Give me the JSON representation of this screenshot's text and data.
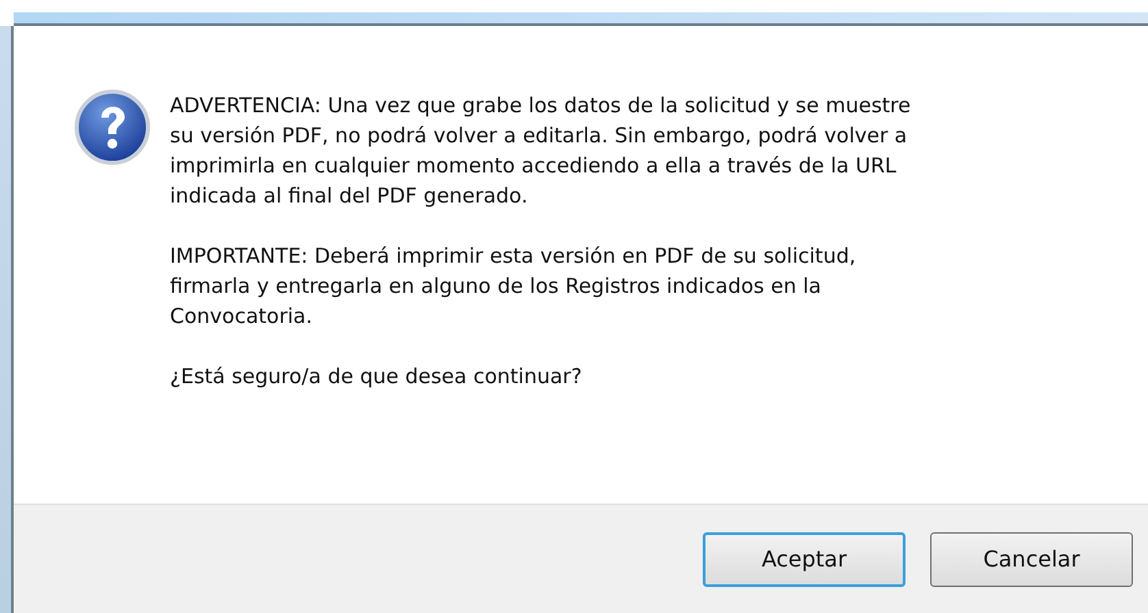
{
  "dialog": {
    "paragraphs": [
      {
        "lines": [
          "ADVERTENCIA: Una vez que grabe los datos de la solicitud y se muestre",
          "su versión PDF, no podrá volver a editarla. Sin embargo, podrá volver a",
          "imprimirla en cualquier momento accediendo a ella a través de la URL",
          "indicada al final del PDF generado."
        ]
      },
      {
        "lines": [
          "IMPORTANTE: Deberá imprimir esta versión en PDF de su solicitud,",
          "firmarla y entregarla en alguno de los Registros indicados en la",
          "Convocatoria."
        ]
      },
      {
        "lines": [
          "¿Está seguro/a de que desea continuar?"
        ]
      }
    ],
    "buttons": [
      {
        "label": "Aceptar",
        "default": true
      },
      {
        "label": "Cancelar",
        "default": false
      }
    ]
  }
}
